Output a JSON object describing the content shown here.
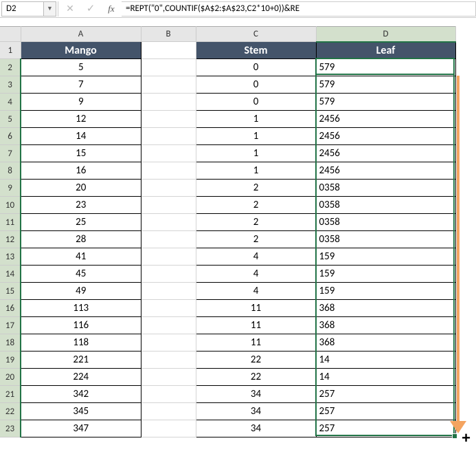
{
  "nameBox": "D2",
  "formulaBar": "=REPT(\"0\",COUNTIF($A$2:$A$23,C2*10+0))&RE",
  "columns": [
    "A",
    "B",
    "C",
    "D"
  ],
  "headers": {
    "A": "Mango",
    "C": "Stem",
    "D": "Leaf"
  },
  "rows": [
    {
      "n": 1,
      "A": "",
      "C": "",
      "D": ""
    },
    {
      "n": 2,
      "A": "5",
      "C": "0",
      "D": "579"
    },
    {
      "n": 3,
      "A": "7",
      "C": "0",
      "D": "579"
    },
    {
      "n": 4,
      "A": "9",
      "C": "0",
      "D": "579"
    },
    {
      "n": 5,
      "A": "12",
      "C": "1",
      "D": "2456"
    },
    {
      "n": 6,
      "A": "14",
      "C": "1",
      "D": "2456"
    },
    {
      "n": 7,
      "A": "15",
      "C": "1",
      "D": "2456"
    },
    {
      "n": 8,
      "A": "16",
      "C": "1",
      "D": "2456"
    },
    {
      "n": 9,
      "A": "20",
      "C": "2",
      "D": "0358"
    },
    {
      "n": 10,
      "A": "23",
      "C": "2",
      "D": "0358"
    },
    {
      "n": 11,
      "A": "25",
      "C": "2",
      "D": "0358"
    },
    {
      "n": 12,
      "A": "28",
      "C": "2",
      "D": "0358"
    },
    {
      "n": 13,
      "A": "41",
      "C": "4",
      "D": "159"
    },
    {
      "n": 14,
      "A": "45",
      "C": "4",
      "D": "159"
    },
    {
      "n": 15,
      "A": "49",
      "C": "4",
      "D": "159"
    },
    {
      "n": 16,
      "A": "113",
      "C": "11",
      "D": "368"
    },
    {
      "n": 17,
      "A": "116",
      "C": "11",
      "D": "368"
    },
    {
      "n": 18,
      "A": "118",
      "C": "11",
      "D": "368"
    },
    {
      "n": 19,
      "A": "221",
      "C": "22",
      "D": "14"
    },
    {
      "n": 20,
      "A": "224",
      "C": "22",
      "D": "14"
    },
    {
      "n": 21,
      "A": "342",
      "C": "34",
      "D": "257"
    },
    {
      "n": 22,
      "A": "345",
      "C": "34",
      "D": "257"
    },
    {
      "n": 23,
      "A": "347",
      "C": "34",
      "D": "257"
    }
  ],
  "selection": {
    "col": "D",
    "startRow": 2,
    "endRow": 23,
    "active": "D2"
  }
}
